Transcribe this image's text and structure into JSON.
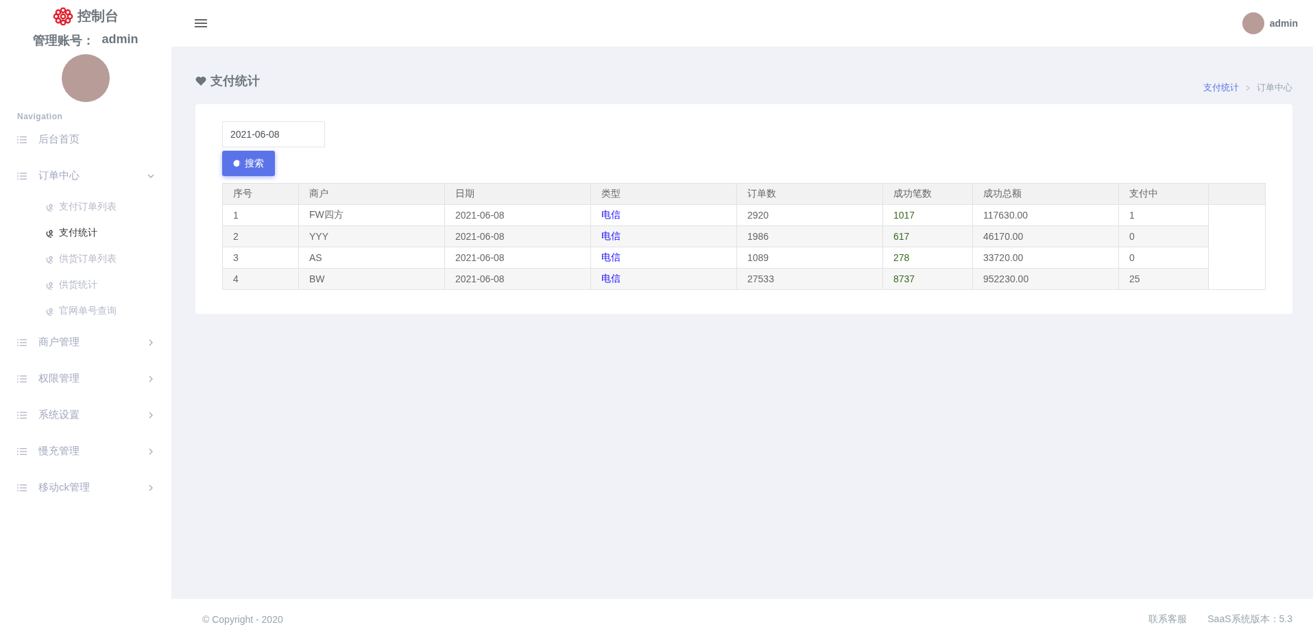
{
  "sidebar": {
    "brand": "控制台",
    "account_label": "管理账号：",
    "account_name": "admin",
    "section_title": "Navigation",
    "items": [
      {
        "label": "后台首页",
        "kind": "link"
      },
      {
        "label": "订单中心",
        "kind": "group",
        "expanded": true,
        "children": [
          {
            "label": "支付订单列表",
            "selected": false
          },
          {
            "label": "支付统计",
            "selected": true
          },
          {
            "label": "供货订单列表",
            "selected": false
          },
          {
            "label": "供货统计",
            "selected": false
          },
          {
            "label": "官网单号查询",
            "selected": false
          }
        ]
      },
      {
        "label": "商户管理",
        "kind": "group",
        "expanded": false
      },
      {
        "label": "权限管理",
        "kind": "group",
        "expanded": false
      },
      {
        "label": "系统设置",
        "kind": "group",
        "expanded": false
      },
      {
        "label": "慢充管理",
        "kind": "group",
        "expanded": false
      },
      {
        "label": "移动ck管理",
        "kind": "group",
        "expanded": false
      }
    ]
  },
  "header": {
    "user": "admin"
  },
  "page": {
    "title": "支付统计",
    "breadcrumb": [
      {
        "label": "支付统计",
        "selected": true
      },
      {
        "label": "订单中心",
        "selected": false
      }
    ]
  },
  "filter": {
    "date": "2021-06-08",
    "search_button": "搜索"
  },
  "table": {
    "columns": [
      "序号",
      "商户",
      "日期",
      "类型",
      "订单数",
      "成功笔数",
      "成功总额",
      "支付中"
    ],
    "rows": [
      [
        "1",
        "FW四方",
        "2021-06-08",
        "电信",
        "2920",
        "1017",
        "117630.00",
        "1"
      ],
      [
        "2",
        "YYY",
        "2021-06-08",
        "电信",
        "1986",
        "617",
        "46170.00",
        "0"
      ],
      [
        "3",
        "AS",
        "2021-06-08",
        "电信",
        "1089",
        "278",
        "33720.00",
        "0"
      ],
      [
        "4",
        "BW",
        "2021-06-08",
        "电信",
        "27533",
        "8737",
        "952230.00",
        "25"
      ]
    ]
  },
  "footer": {
    "copyright": "© Copyright - 2020",
    "links": [
      "联系客服",
      "SaaS系统版本：5.3"
    ]
  }
}
